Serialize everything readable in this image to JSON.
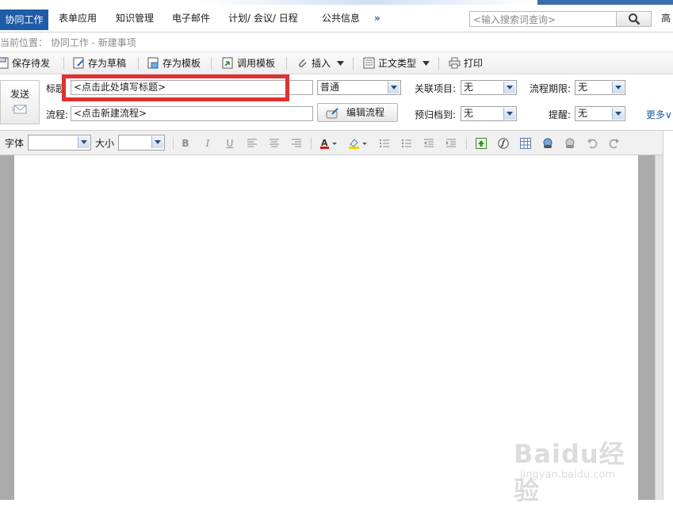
{
  "nav": {
    "tabs": [
      "协同工作",
      "表单应用",
      "知识管理",
      "电子邮件",
      "计划/ 会议/ 日程",
      "公共信息"
    ],
    "more": "»",
    "search_placeholder": "<输入搜索词查询>",
    "right_label": "高"
  },
  "breadcrumb": {
    "text": "当前位置： 协同工作 - 新建事项"
  },
  "actions": {
    "save_pending": "保存待发",
    "save_draft": "存为草稿",
    "save_template": "存为模板",
    "use_template": "调用模板",
    "insert": "插入",
    "body_type": "正文类型",
    "print": "打印"
  },
  "form": {
    "send": "发送",
    "title_label": "标题",
    "title_value": "<点击此处填写标题>",
    "priority_value": "普通",
    "related_label": "关联项目:",
    "related_value": "无",
    "deadline_label": "流程期限:",
    "deadline_value": "无",
    "flow_label": "流程:",
    "flow_value": "<点击新建流程>",
    "edit_flow": "编辑流程",
    "archive_label": "预归档到:",
    "archive_value": "无",
    "remind_label": "提醒:",
    "remind_value": "无",
    "more": "更多"
  },
  "editor": {
    "font_label": "字体",
    "size_label": "大小",
    "bold": "B",
    "italic": "I",
    "underline": "U"
  },
  "watermark": {
    "main": "Baidu经验",
    "sub": "jingyan.baidu.com"
  },
  "colors": {
    "nav_active_bg": "#1e5ca8",
    "highlight_red": "#e03131",
    "link_blue": "#1e5ca8"
  }
}
